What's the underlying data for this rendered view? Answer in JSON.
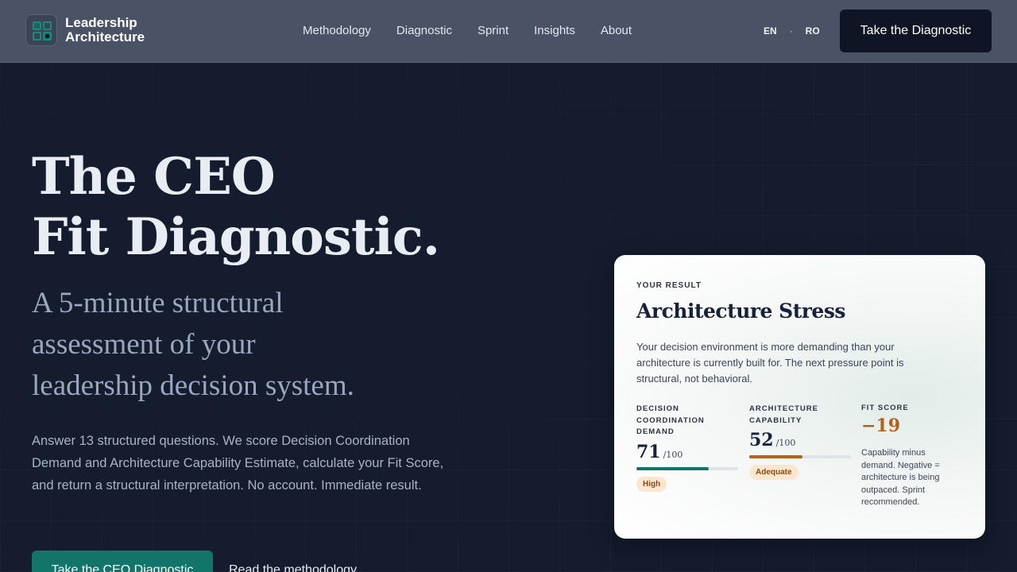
{
  "header": {
    "brand_line1": "Leadership",
    "brand_line2": "Architecture",
    "nav": [
      "Methodology",
      "Diagnostic",
      "Sprint",
      "Insights",
      "About"
    ],
    "lang_en": "EN",
    "lang_sep": "·",
    "lang_ro": "RO",
    "cta": "Take the Diagnostic"
  },
  "hero": {
    "title_line1": "The CEO",
    "title_line2": "Fit Diagnostic.",
    "subtitle_line1": "A 5-minute structural",
    "subtitle_line2": "assessment of your",
    "subtitle_line3": "leadership decision system.",
    "body": "Answer 13 structured questions. We score Decision Coordination Demand and Architecture Capability Estimate, calculate your Fit Score, and return a structural interpretation. No account. Immediate result.",
    "cta_primary": "Take the CEO Diagnostic",
    "cta_secondary": "Read the methodology"
  },
  "result_card": {
    "eyebrow": "YOUR RESULT",
    "title": "Architecture Stress",
    "description": "Your decision environment is more demanding than your architecture is currently built for. The next pressure point is structural, not behavioral.",
    "metrics": [
      {
        "label": "DECISION COORDINATION DEMAND",
        "value": "71",
        "max": "/100",
        "fraction": 0.71,
        "bar_color": "#12756a",
        "badge": "High"
      },
      {
        "label": "ARCHITECTURE CAPABILITY",
        "value": "52",
        "max": "/100",
        "fraction": 0.52,
        "bar_color": "#b6601a",
        "badge": "Adequate"
      }
    ],
    "fit": {
      "label": "FIT SCORE",
      "value": "−19",
      "note": "Capability minus demand. Negative = architecture is being outpaced. Sprint recommended."
    }
  }
}
